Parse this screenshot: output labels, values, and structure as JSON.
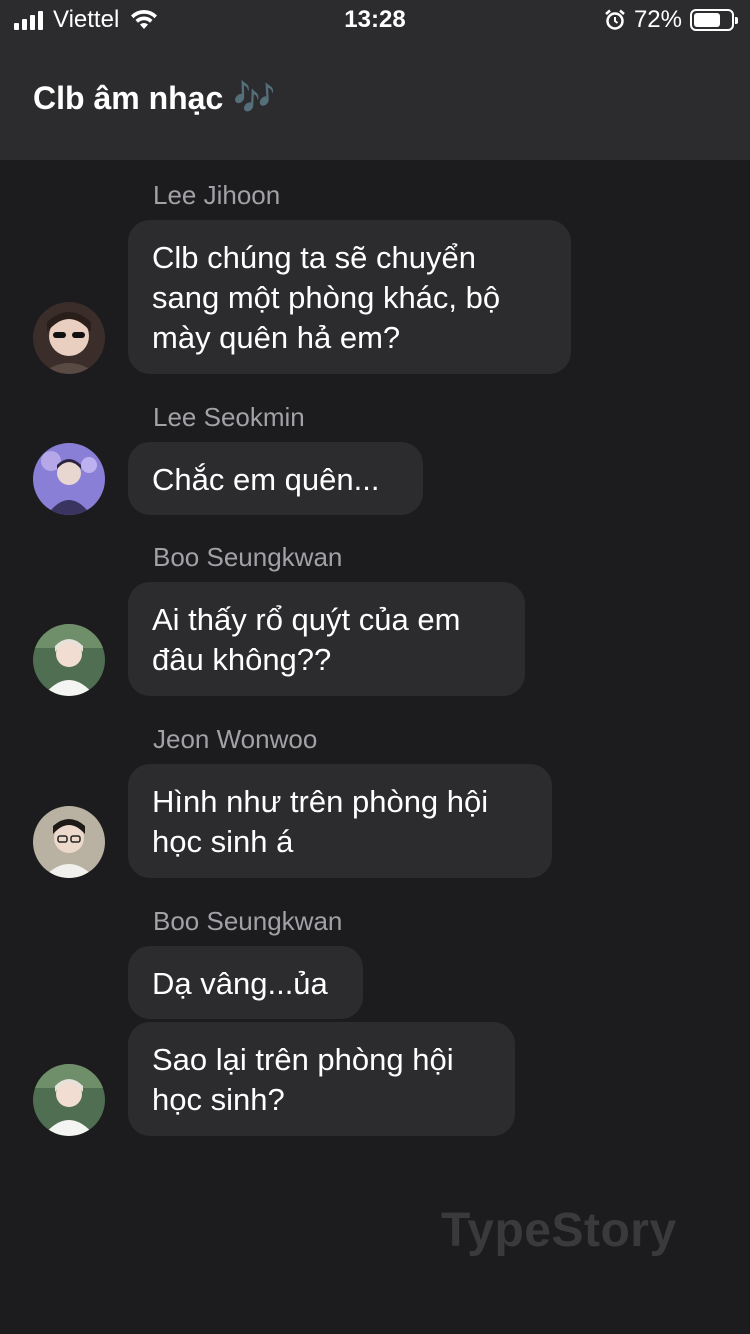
{
  "status_bar": {
    "carrier": "Viettel",
    "time": "13:28",
    "battery_percent": "72%",
    "battery_level": 0.72,
    "icons": [
      "signal-icon",
      "wifi-icon",
      "alarm-icon",
      "battery-icon"
    ]
  },
  "header": {
    "title": "Clb âm nhạc",
    "title_emoji": "🎶"
  },
  "messages": [
    {
      "sender": "Lee Jihoon",
      "bubbles": [
        "Clb chúng ta sẽ chuyển\nsang một phòng khác, bộ\nmày quên hả em?"
      ]
    },
    {
      "sender": "Lee Seokmin",
      "bubbles": [
        "Chắc em quên..."
      ]
    },
    {
      "sender": "Boo Seungkwan",
      "bubbles": [
        "Ai thấy rổ quýt của em\nđâu không??"
      ]
    },
    {
      "sender": "Jeon Wonwoo",
      "bubbles": [
        "Hình như trên phòng hội\nhọc sinh á"
      ]
    },
    {
      "sender": "Boo Seungkwan",
      "bubbles": [
        "Dạ vâng...ủa",
        "Sao lại trên phòng hội\nhọc sinh?"
      ]
    }
  ],
  "watermark": "TypeStory",
  "colors": {
    "background": "#1c1c1e",
    "header": "#2c2c2e",
    "bubble": "#2c2c2e",
    "sender_name": "#a1a1a6",
    "watermark": "#3a3a3c"
  }
}
